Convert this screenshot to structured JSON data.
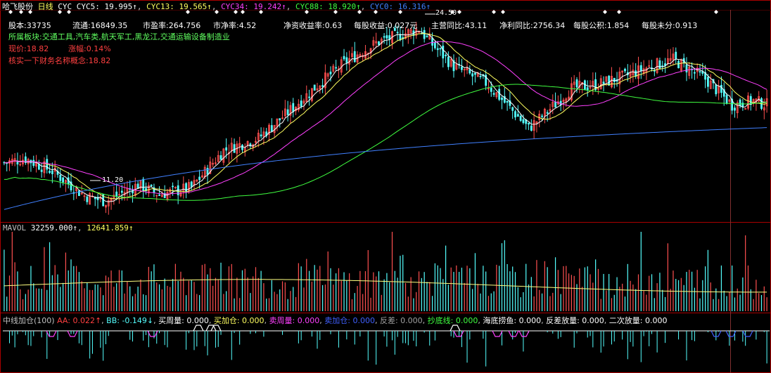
{
  "header": {
    "stock_name": "哈飞股份",
    "period": "日线",
    "indicator": "CYC",
    "cyc5": "CYC5: 19.995↑",
    "cyc13": "CYC13: 19.565↑",
    "cyc34": "CYC34: 19.242↑",
    "cyc88": "CYC88: 18.920↑",
    "cyc0": "CYC0: 16.316↑"
  },
  "info": {
    "total_shares": "股本:33735",
    "float_shares": "流通:16849.35",
    "pe": "市盈率:264.756",
    "pb": "市净率:4.52",
    "roe": "净资收益率:0.63",
    "eps": "每股收益:0.027元",
    "rev_yoy": "主营同比:43.11",
    "profit_yoy": "净利同比:2756.34",
    "reserve": "每股公积:1.854",
    "undistributed": "每股未分:0.913",
    "sectors": "所属板块:交通工具,汽车类,航天军工,黑龙江,交通运输设备制造业",
    "price": "现价:18.82",
    "change": "涨幅:0.14%",
    "note": "核实一下财务名称概念:18.82"
  },
  "price_labels": {
    "high": "24.50",
    "low": "11.20"
  },
  "volume_panel": {
    "title": "MAVOL",
    "v1": "32259.000↑",
    "v2": "12641.859↑"
  },
  "indicator_panel": {
    "name": "中线加仓(100)",
    "aa": "AA: 0.022↑",
    "bb": "BB: -0.149↓",
    "buy_week": "买周量: 0.000",
    "buy_add": "买加仓: 0.000",
    "sell_week": "卖周量: 0.000",
    "sell_add": "卖加仓: 0.000",
    "reverse": "反差: 0.000",
    "bottom_line": "抄底线: 0.000",
    "sea_fish": "海底捞鱼: 0.000",
    "reverse_vol": "反差放量: 0.000",
    "second_vol": "二次放量: 0.000"
  },
  "colors": {
    "up": "#ff5050",
    "down": "#54ffff",
    "cyc5": "#ffffff",
    "cyc13": "#ffff60",
    "cyc34": "#ff40ff",
    "cyc88": "#40ff40",
    "cyc0": "#4080ff",
    "grid": "#aa0000"
  },
  "chart_data": {
    "type": "candlestick",
    "price_range": [
      10.5,
      25.5
    ],
    "anchors": [
      [
        0,
        14.6
      ],
      [
        8,
        14.9
      ],
      [
        18,
        14.0
      ],
      [
        30,
        12.2
      ],
      [
        38,
        11.8
      ],
      [
        50,
        13.0
      ],
      [
        58,
        12.3
      ],
      [
        70,
        12.8
      ],
      [
        82,
        15.5
      ],
      [
        95,
        16.4
      ],
      [
        108,
        18.6
      ],
      [
        118,
        20.4
      ],
      [
        128,
        22.0
      ],
      [
        140,
        23.4
      ],
      [
        155,
        24.3
      ],
      [
        160,
        23.2
      ],
      [
        168,
        21.6
      ],
      [
        180,
        20.4
      ],
      [
        188,
        18.8
      ],
      [
        196,
        17.1
      ],
      [
        204,
        18.5
      ],
      [
        212,
        20.0
      ],
      [
        222,
        20.3
      ],
      [
        232,
        20.9
      ],
      [
        240,
        21.5
      ],
      [
        250,
        22.1
      ],
      [
        262,
        20.7
      ],
      [
        272,
        18.8
      ],
      [
        280,
        19.1
      ],
      [
        285,
        18.82
      ]
    ]
  }
}
